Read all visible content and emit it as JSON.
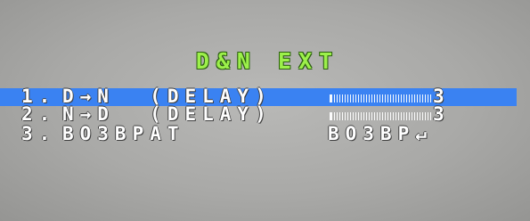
{
  "osd": {
    "title": "D&N EXT",
    "rows": [
      {
        "number": "1.",
        "label": "D→N  (DELAY)",
        "value": "3",
        "selected": true
      },
      {
        "number": "2.",
        "label": "N→D  (DELAY)",
        "value": "3",
        "selected": false
      },
      {
        "number": "3.",
        "label": "BO3BPAT",
        "value": "BO3BP↵",
        "selected": false
      }
    ],
    "colors": {
      "selection_bar": "#3a82f2",
      "title_text": "#9cf04a",
      "menu_text": "#ffffff",
      "background": "#a9a9a7"
    }
  }
}
